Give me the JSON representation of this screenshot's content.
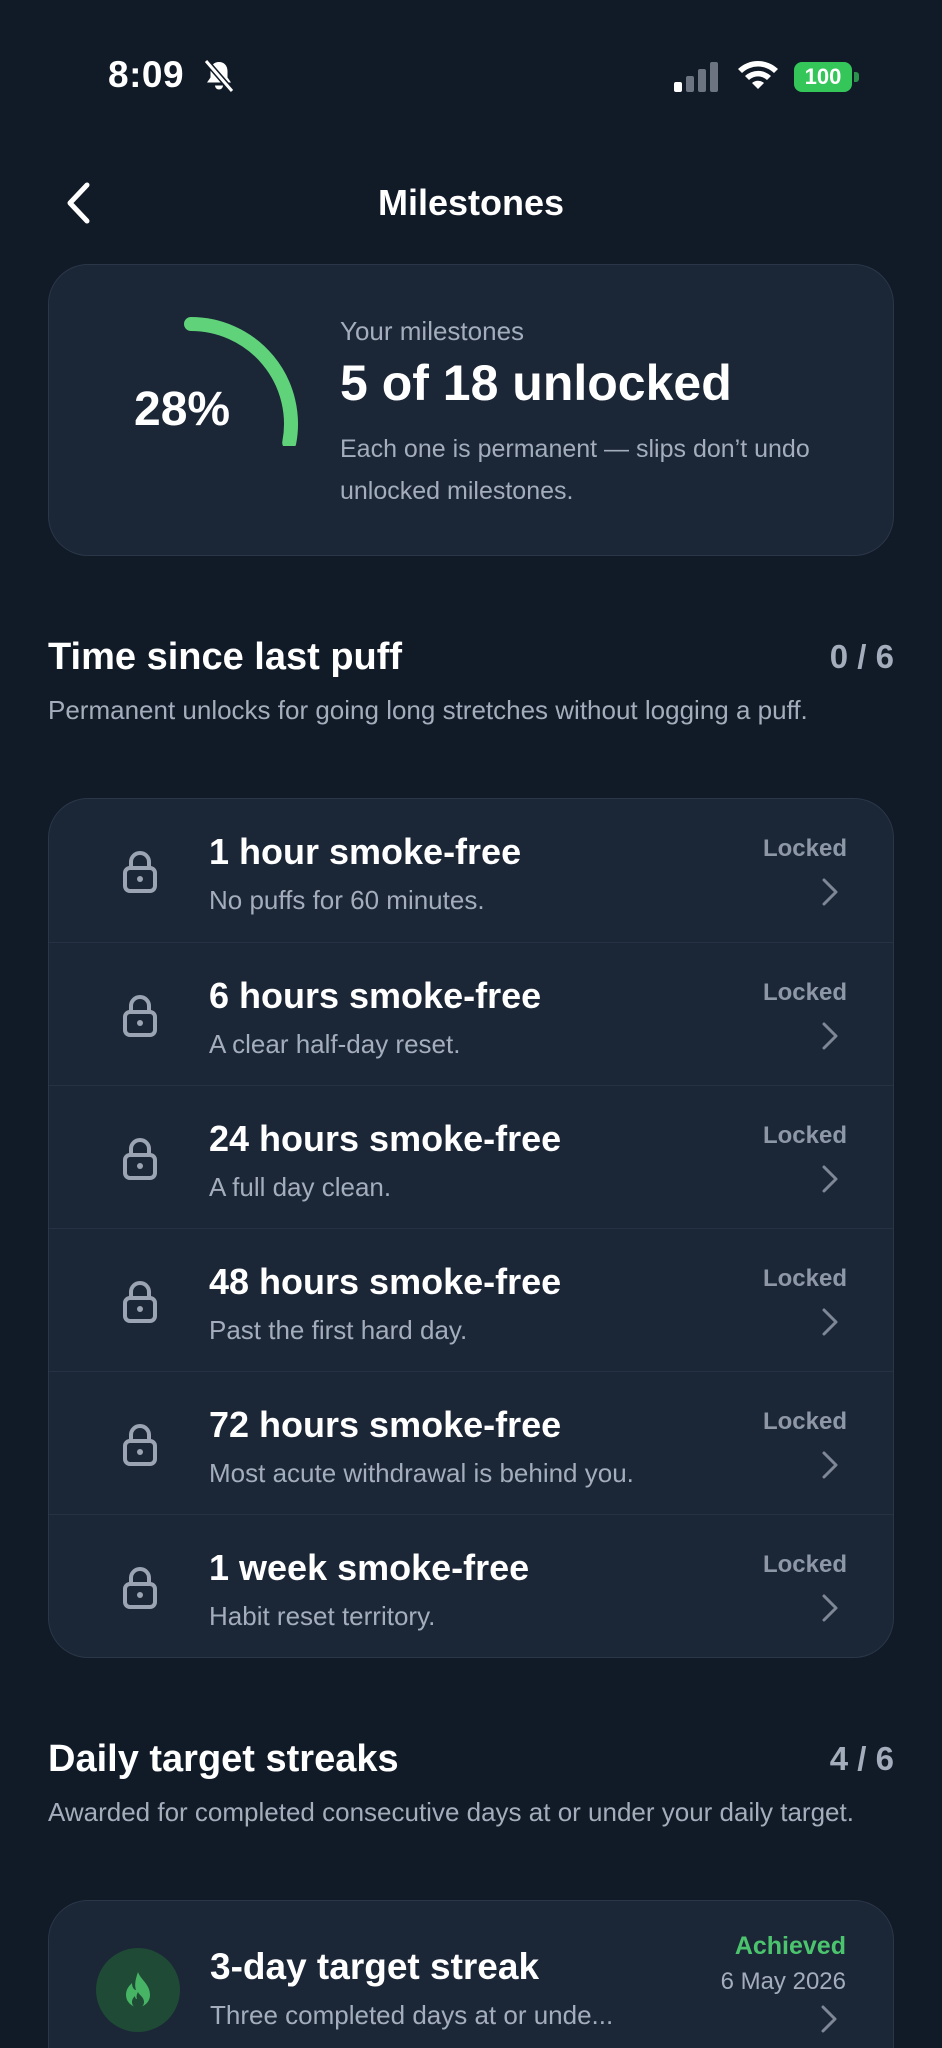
{
  "status_bar": {
    "time": "8:09",
    "battery": "100"
  },
  "nav": {
    "title": "Milestones"
  },
  "summary": {
    "percent_label": "28%",
    "progress": 0.28,
    "kicker": "Your milestones",
    "headline": "5 of 18 unlocked",
    "note": "Each one is permanent — slips don’t undo unlocked milestones."
  },
  "sections": [
    {
      "title": "Time since last puff",
      "count": "0 / 6",
      "description": "Permanent unlocks for going long stretches without logging a puff.",
      "items": [
        {
          "title": "1 hour smoke-free",
          "subtitle": "No puffs for 60 minutes.",
          "status": "Locked"
        },
        {
          "title": "6 hours smoke-free",
          "subtitle": "A clear half-day reset.",
          "status": "Locked"
        },
        {
          "title": "24 hours smoke-free",
          "subtitle": "A full day clean.",
          "status": "Locked"
        },
        {
          "title": "48 hours smoke-free",
          "subtitle": "Past the first hard day.",
          "status": "Locked"
        },
        {
          "title": "72 hours smoke-free",
          "subtitle": "Most acute withdrawal is behind you.",
          "status": "Locked"
        },
        {
          "title": "1 week smoke-free",
          "subtitle": "Habit reset territory.",
          "status": "Locked"
        }
      ]
    },
    {
      "title": "Daily target streaks",
      "count": "4 / 6",
      "description": "Awarded for completed consecutive days at or under your daily target.",
      "items": [
        {
          "title": "3-day target streak",
          "subtitle": "Three completed days at or unde...",
          "status": "Achieved",
          "date": "6 May 2026"
        }
      ]
    }
  ],
  "colors": {
    "background": "#111a27",
    "card": "#1b2637",
    "accent_green": "#4cc46e",
    "muted_text": "#a3adbb"
  },
  "icons": {
    "back": "chevron-left-icon",
    "lock": "lock-icon",
    "flame": "flame-icon",
    "chevron": "chevron-right-icon"
  }
}
